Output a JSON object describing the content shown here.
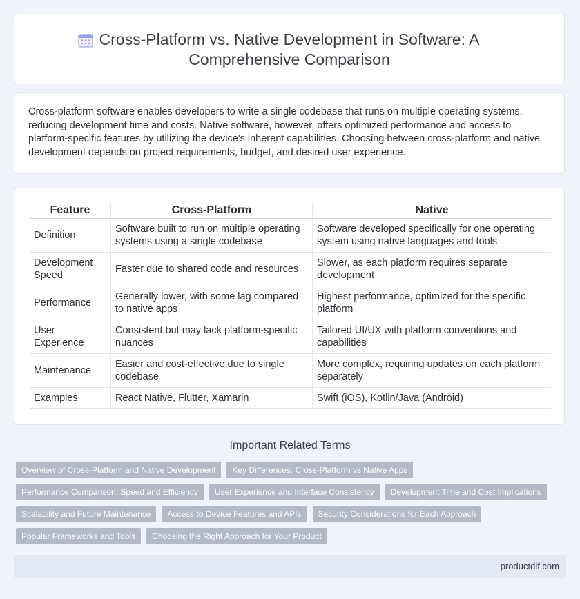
{
  "header": {
    "title": "Cross-Platform vs. Native Development in Software: A Comprehensive Comparison",
    "icon": "calendar-icon"
  },
  "intro": {
    "text": "Cross-platform software enables developers to write a single codebase that runs on multiple operating systems, reducing development time and costs. Native software, however, offers optimized performance and access to platform-specific features by utilizing the device's inherent capabilities. Choosing between cross-platform and native development depends on project requirements, budget, and desired user experience."
  },
  "table": {
    "headers": [
      "Feature",
      "Cross-Platform",
      "Native"
    ],
    "rows": [
      [
        "Definition",
        "Software built to run on multiple operating systems using a single codebase",
        "Software developed specifically for one operating system using native languages and tools"
      ],
      [
        "Development Speed",
        "Faster due to shared code and resources",
        "Slower, as each platform requires separate development"
      ],
      [
        "Performance",
        "Generally lower, with some lag compared to native apps",
        "Highest performance, optimized for the specific platform"
      ],
      [
        "User Experience",
        "Consistent but may lack platform-specific nuances",
        "Tailored UI/UX with platform conventions and capabilities"
      ],
      [
        "Maintenance",
        "Easier and cost-effective due to single codebase",
        "More complex, requiring updates on each platform separately"
      ],
      [
        "Examples",
        "React Native, Flutter, Xamarin",
        "Swift (iOS), Kotlin/Java (Android)"
      ]
    ]
  },
  "related": {
    "heading": "Important Related Terms",
    "tags": [
      "Overview of Cross-Platform and Native Development",
      "Key Differences: Cross-Platform vs Native Apps",
      "Performance Comparison: Speed and Efficiency",
      "User Experience and Interface Consistency",
      "Development Time and Cost Implications",
      "Scalability and Future Maintenance",
      "Access to Device Features and APIs",
      "Security Considerations for Each Approach",
      "Popular Frameworks and Tools",
      "Choosing the Right Approach for Your Product"
    ]
  },
  "footer": {
    "site": "productdif.com"
  },
  "colors": {
    "background": "#f0f3f9",
    "tag_background": "#b3bac5",
    "footer_background": "#e4eaf4",
    "icon_accent": "#c48ee0"
  }
}
